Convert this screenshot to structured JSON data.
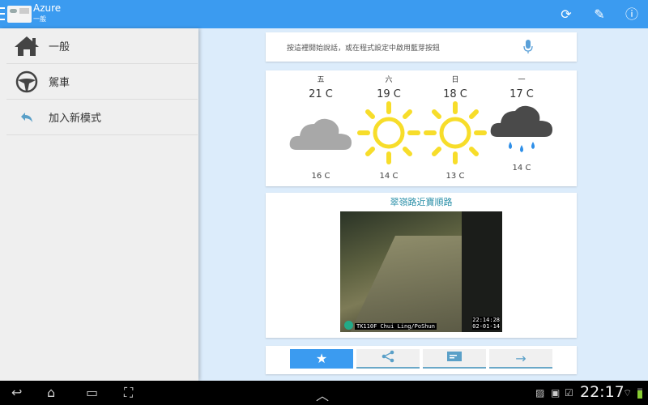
{
  "app": {
    "title": "Azure",
    "subtitle": "一般"
  },
  "toolbar": {
    "refresh": "⟳",
    "edit": "✎",
    "info": "ⓘ"
  },
  "sidebar": {
    "items": [
      {
        "label": "一般",
        "icon": "home-icon"
      },
      {
        "label": "駕車",
        "icon": "steering-wheel-icon"
      },
      {
        "label": "加入新模式",
        "icon": "reply-arrow-icon"
      }
    ]
  },
  "voice": {
    "hint": "按這裡開始說話，或在程式設定中啟用藍芽按鈕"
  },
  "weather": {
    "days": [
      {
        "day": "五",
        "high": "21 C",
        "low": "16 C",
        "condition": "cloudy"
      },
      {
        "day": "六",
        "high": "19 C",
        "low": "14 C",
        "condition": "sunny"
      },
      {
        "day": "日",
        "high": "18 C",
        "low": "13 C",
        "condition": "sunny"
      },
      {
        "day": "一",
        "high": "17 C",
        "low": "14 C",
        "condition": "rain"
      }
    ]
  },
  "camera": {
    "title": "翠嶺路近寶順路",
    "caption": "TK110F Chui Ling/PoShun",
    "time": "22:14:28",
    "date": "02-01-14"
  },
  "actions": [
    {
      "icon": "star-icon",
      "glyph": "★"
    },
    {
      "icon": "share-icon",
      "glyph": "⋖"
    },
    {
      "icon": "message-icon",
      "glyph": "▬"
    },
    {
      "icon": "arrow-right-icon",
      "glyph": "→"
    }
  ],
  "system": {
    "time": "22:17"
  },
  "colors": {
    "accent": "#3b9bf0",
    "sun": "#f7dd2a",
    "cloud": "#a8a8a8",
    "raincloud": "#4a4a4a",
    "rain": "#2e8fe8"
  }
}
